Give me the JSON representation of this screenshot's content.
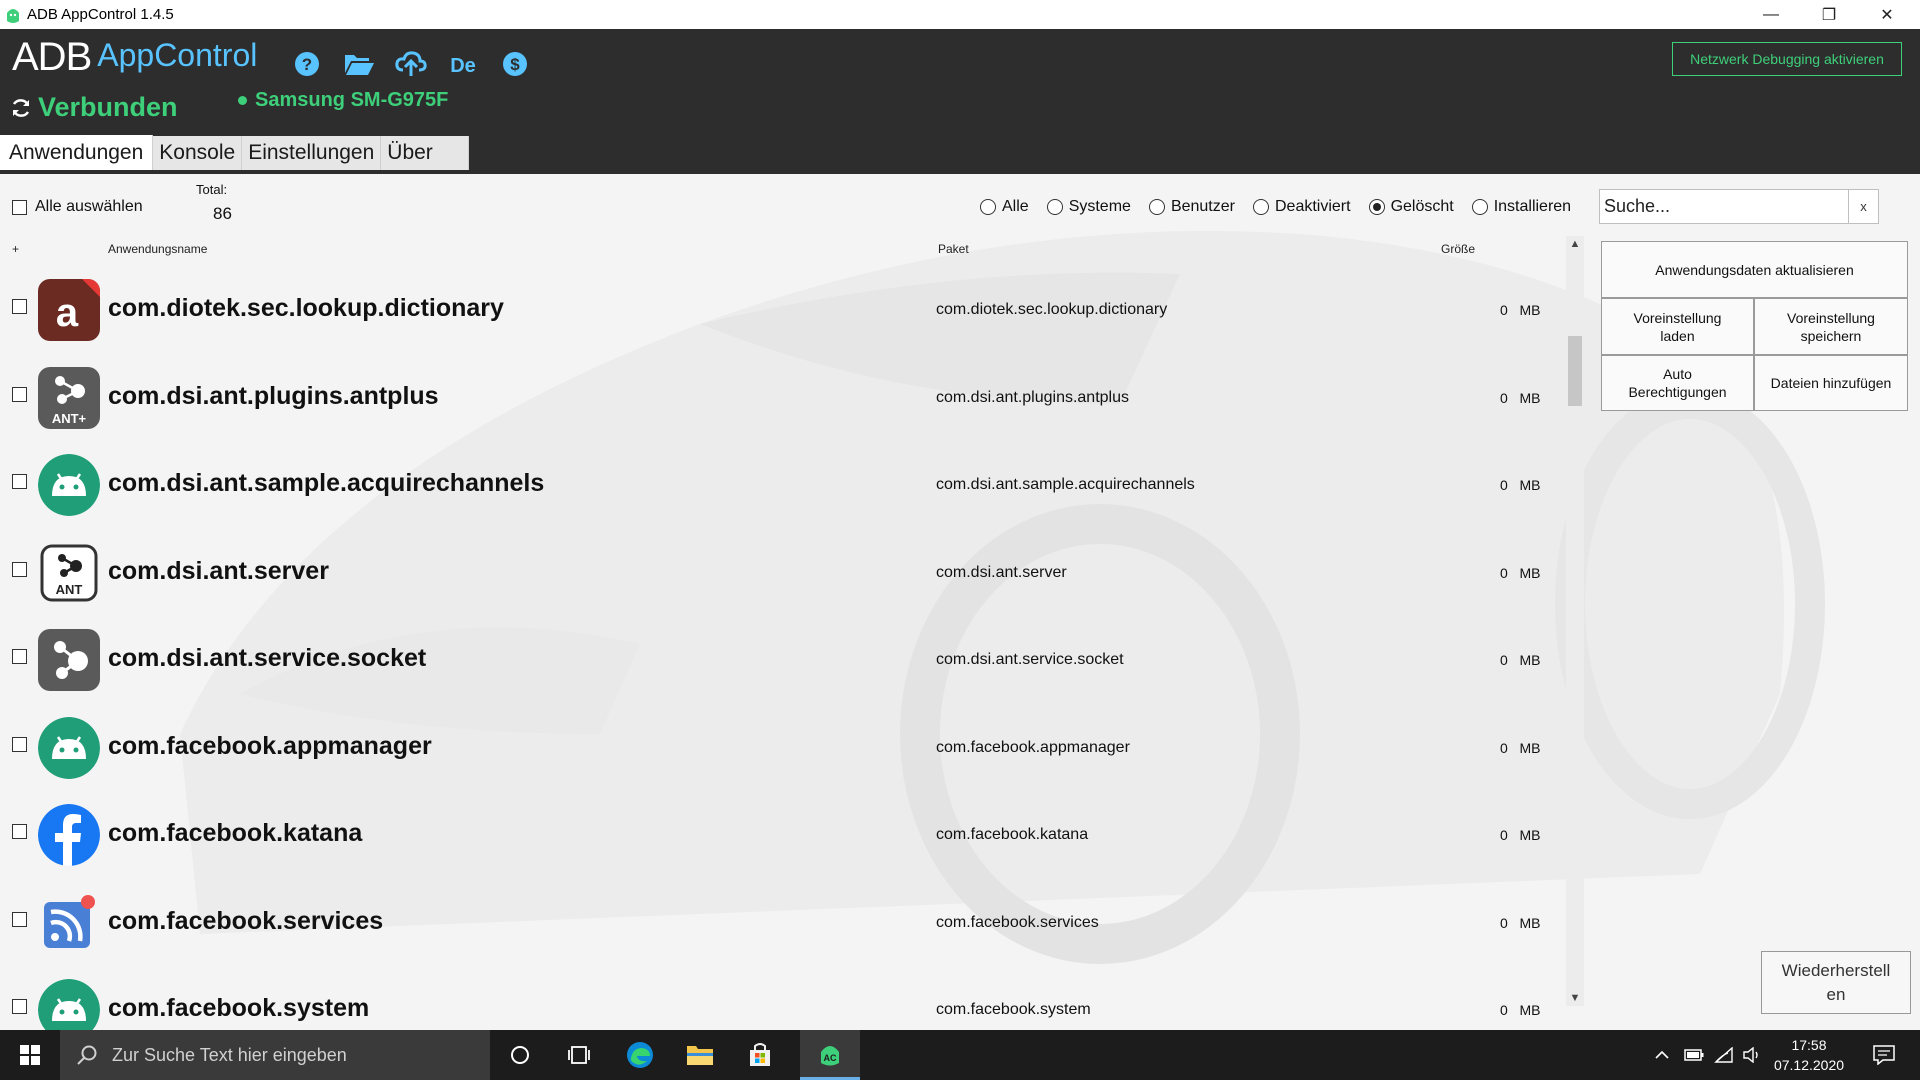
{
  "window": {
    "title": "ADB AppControl 1.4.5",
    "minimize": "—",
    "maximize": "❐",
    "close": "✕"
  },
  "header": {
    "logo_adb": "ADB",
    "logo_appcontrol": "AppControl",
    "toolbar_icons": [
      "help-icon",
      "folder-open-icon",
      "upload-icon",
      "language-de-icon",
      "donate-icon"
    ],
    "status": "Verbunden",
    "device": "Samsung SM-G975F",
    "network_debug_button": "Netzwerk Debugging aktivieren",
    "accent_color": "#3ecf7a",
    "logo_accent_color": "#58c3ff"
  },
  "tabs": [
    {
      "label": "Anwendungen",
      "active": true
    },
    {
      "label": "Konsole",
      "active": false
    },
    {
      "label": "Einstellungen",
      "active": false
    },
    {
      "label": "Über",
      "active": false
    }
  ],
  "toolbar": {
    "select_all": "Alle auswählen",
    "total_label": "Total:",
    "total_value": "86",
    "filters": [
      {
        "label": "Alle",
        "selected": false
      },
      {
        "label": "Systeme",
        "selected": false
      },
      {
        "label": "Benutzer",
        "selected": false
      },
      {
        "label": "Deaktiviert",
        "selected": false
      },
      {
        "label": "Gelöscht",
        "selected": true
      },
      {
        "label": "Installieren",
        "selected": false
      }
    ],
    "search_placeholder": "Suche...",
    "search_clear": "x"
  },
  "columns": {
    "sort": "+",
    "name": "Anwendungsname",
    "package": "Paket",
    "size": "Größe"
  },
  "apps": [
    {
      "name": "com.diotek.sec.lookup.dictionary",
      "package": "com.diotek.sec.lookup.dictionary",
      "size": "0",
      "unit": "MB",
      "icon": "dictionary-icon"
    },
    {
      "name": "com.dsi.ant.plugins.antplus",
      "package": "com.dsi.ant.plugins.antplus",
      "size": "0",
      "unit": "MB",
      "icon": "ant-plus-icon",
      "icon_text": "ANT+"
    },
    {
      "name": "com.dsi.ant.sample.acquirechannels",
      "package": "com.dsi.ant.sample.acquirechannels",
      "size": "0",
      "unit": "MB",
      "icon": "android-icon"
    },
    {
      "name": "com.dsi.ant.server",
      "package": "com.dsi.ant.server",
      "size": "0",
      "unit": "MB",
      "icon": "ant-icon",
      "icon_text": "ANT"
    },
    {
      "name": "com.dsi.ant.service.socket",
      "package": "com.dsi.ant.service.socket",
      "size": "0",
      "unit": "MB",
      "icon": "ant-socket-icon"
    },
    {
      "name": "com.facebook.appmanager",
      "package": "com.facebook.appmanager",
      "size": "0",
      "unit": "MB",
      "icon": "android-icon"
    },
    {
      "name": "com.facebook.katana",
      "package": "com.facebook.katana",
      "size": "0",
      "unit": "MB",
      "icon": "facebook-icon"
    },
    {
      "name": "com.facebook.services",
      "package": "com.facebook.services",
      "size": "0",
      "unit": "MB",
      "icon": "rss-icon"
    },
    {
      "name": "com.facebook.system",
      "package": "com.facebook.system",
      "size": "0",
      "unit": "MB",
      "icon": "android-icon"
    }
  ],
  "actions": {
    "refresh": "Anwendungsdaten aktualisieren",
    "load_preset_1": "Voreinstellung",
    "load_preset_2": "laden",
    "save_preset_1": "Voreinstellung",
    "save_preset_2": "speichern",
    "auto_perm_1": "Auto",
    "auto_perm_2": "Berechtigungen",
    "add_files": "Dateien hinzufügen",
    "restore_1": "Wiederherstell",
    "restore_2": "en"
  },
  "taskbar": {
    "search_placeholder": "Zur Suche Text hier eingeben",
    "time": "17:58",
    "date": "07.12.2020",
    "apps": [
      "cortana-icon",
      "task-view-icon",
      "edge-icon",
      "file-explorer-icon",
      "store-icon",
      "adb-appcontrol-icon"
    ]
  }
}
